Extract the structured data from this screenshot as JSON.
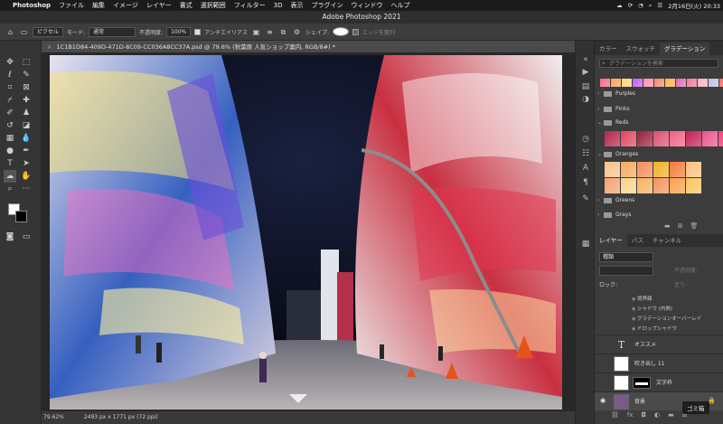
{
  "menubar": {
    "app": "Photoshop",
    "items": [
      "ファイル",
      "編集",
      "イメージ",
      "レイヤー",
      "書式",
      "選択範囲",
      "フィルター",
      "3D",
      "表示",
      "プラグイン",
      "ウィンドウ",
      "ヘルプ"
    ],
    "datetime": "2月16日(火)  20:33"
  },
  "window": {
    "title": "Adobe Photoshop 2021"
  },
  "options": {
    "tool_preset": "ピクセル",
    "mode_label": "モード:",
    "mode_value": "通常",
    "opacity_label": "不透明度:",
    "opacity_value": "100%",
    "antialias_label": "アンチエイリアス",
    "shape_label": "シェイプ:",
    "align_edges": "エッジを整列"
  },
  "document": {
    "tab_title": "1C1B1D84-409D-471D-8C09-CC036A8CC37A.psd @ 79.6% (秋葉原 人気ショップ案内, RGB/8#) *",
    "close_glyph": "×",
    "zoom": "79.62%",
    "size_info": "2493 px x 1771 px (72 ppi)"
  },
  "gradient_panel": {
    "tabs": [
      "カラー",
      "スウォッチ",
      "グラデーション"
    ],
    "search_placeholder": "グラデーションを検索",
    "groups": [
      {
        "name": "Purples",
        "open": false
      },
      {
        "name": "Pinks",
        "open": false
      },
      {
        "name": "Reds",
        "open": true
      },
      {
        "name": "Oranges",
        "open": true
      },
      {
        "name": "Greens",
        "open": false
      },
      {
        "name": "Grays",
        "open": false
      }
    ],
    "recent_swatches": [
      "#f36a8a",
      "#f4a55a",
      "#f6d67a",
      "#c15cf0",
      "#ff8fb0",
      "#f08a6a",
      "#ffb347",
      "#e06ab0",
      "#f07a9a",
      "#f3b4c8",
      "#c0c0e0",
      "#ff6a6a",
      "#ffa07a",
      "#ffd700"
    ],
    "reds_swatches": [
      "#b5214a",
      "#e2445c",
      "#9b1c3a",
      "#d94f70",
      "#f06080",
      "#c41e55",
      "#e8538f",
      "#f2447a"
    ],
    "oranges_swatches": [
      "#f6c28b",
      "#f8a85a",
      "#f58a5a",
      "#f0b020",
      "#f47a3a",
      "#f9c07a",
      "#f5a070",
      "#fbd28a",
      "#f8b060",
      "#f3925a",
      "#f6a04a",
      "#fac35a"
    ]
  },
  "layers_panel": {
    "tabs": [
      "レイヤー",
      "パス",
      "チャンネル"
    ],
    "filter": "種類",
    "blend_mode": "",
    "opacity_label": "不透明度:",
    "fill_label": "塗り:",
    "lock_label": "ロック:",
    "effects": [
      "境界線",
      "シャドウ (内側)",
      "グラデーションオーバーレイ",
      "ドロップシャドウ"
    ],
    "layers": [
      {
        "name": "オススメ",
        "type": "text",
        "visible": false
      },
      {
        "name": "吹き出し 11",
        "type": "shape",
        "visible": false
      },
      {
        "name": "文字枠",
        "type": "mask",
        "visible": false
      },
      {
        "name": "背景",
        "type": "image",
        "visible": true
      }
    ],
    "trash_tooltip": "ゴミ箱"
  }
}
